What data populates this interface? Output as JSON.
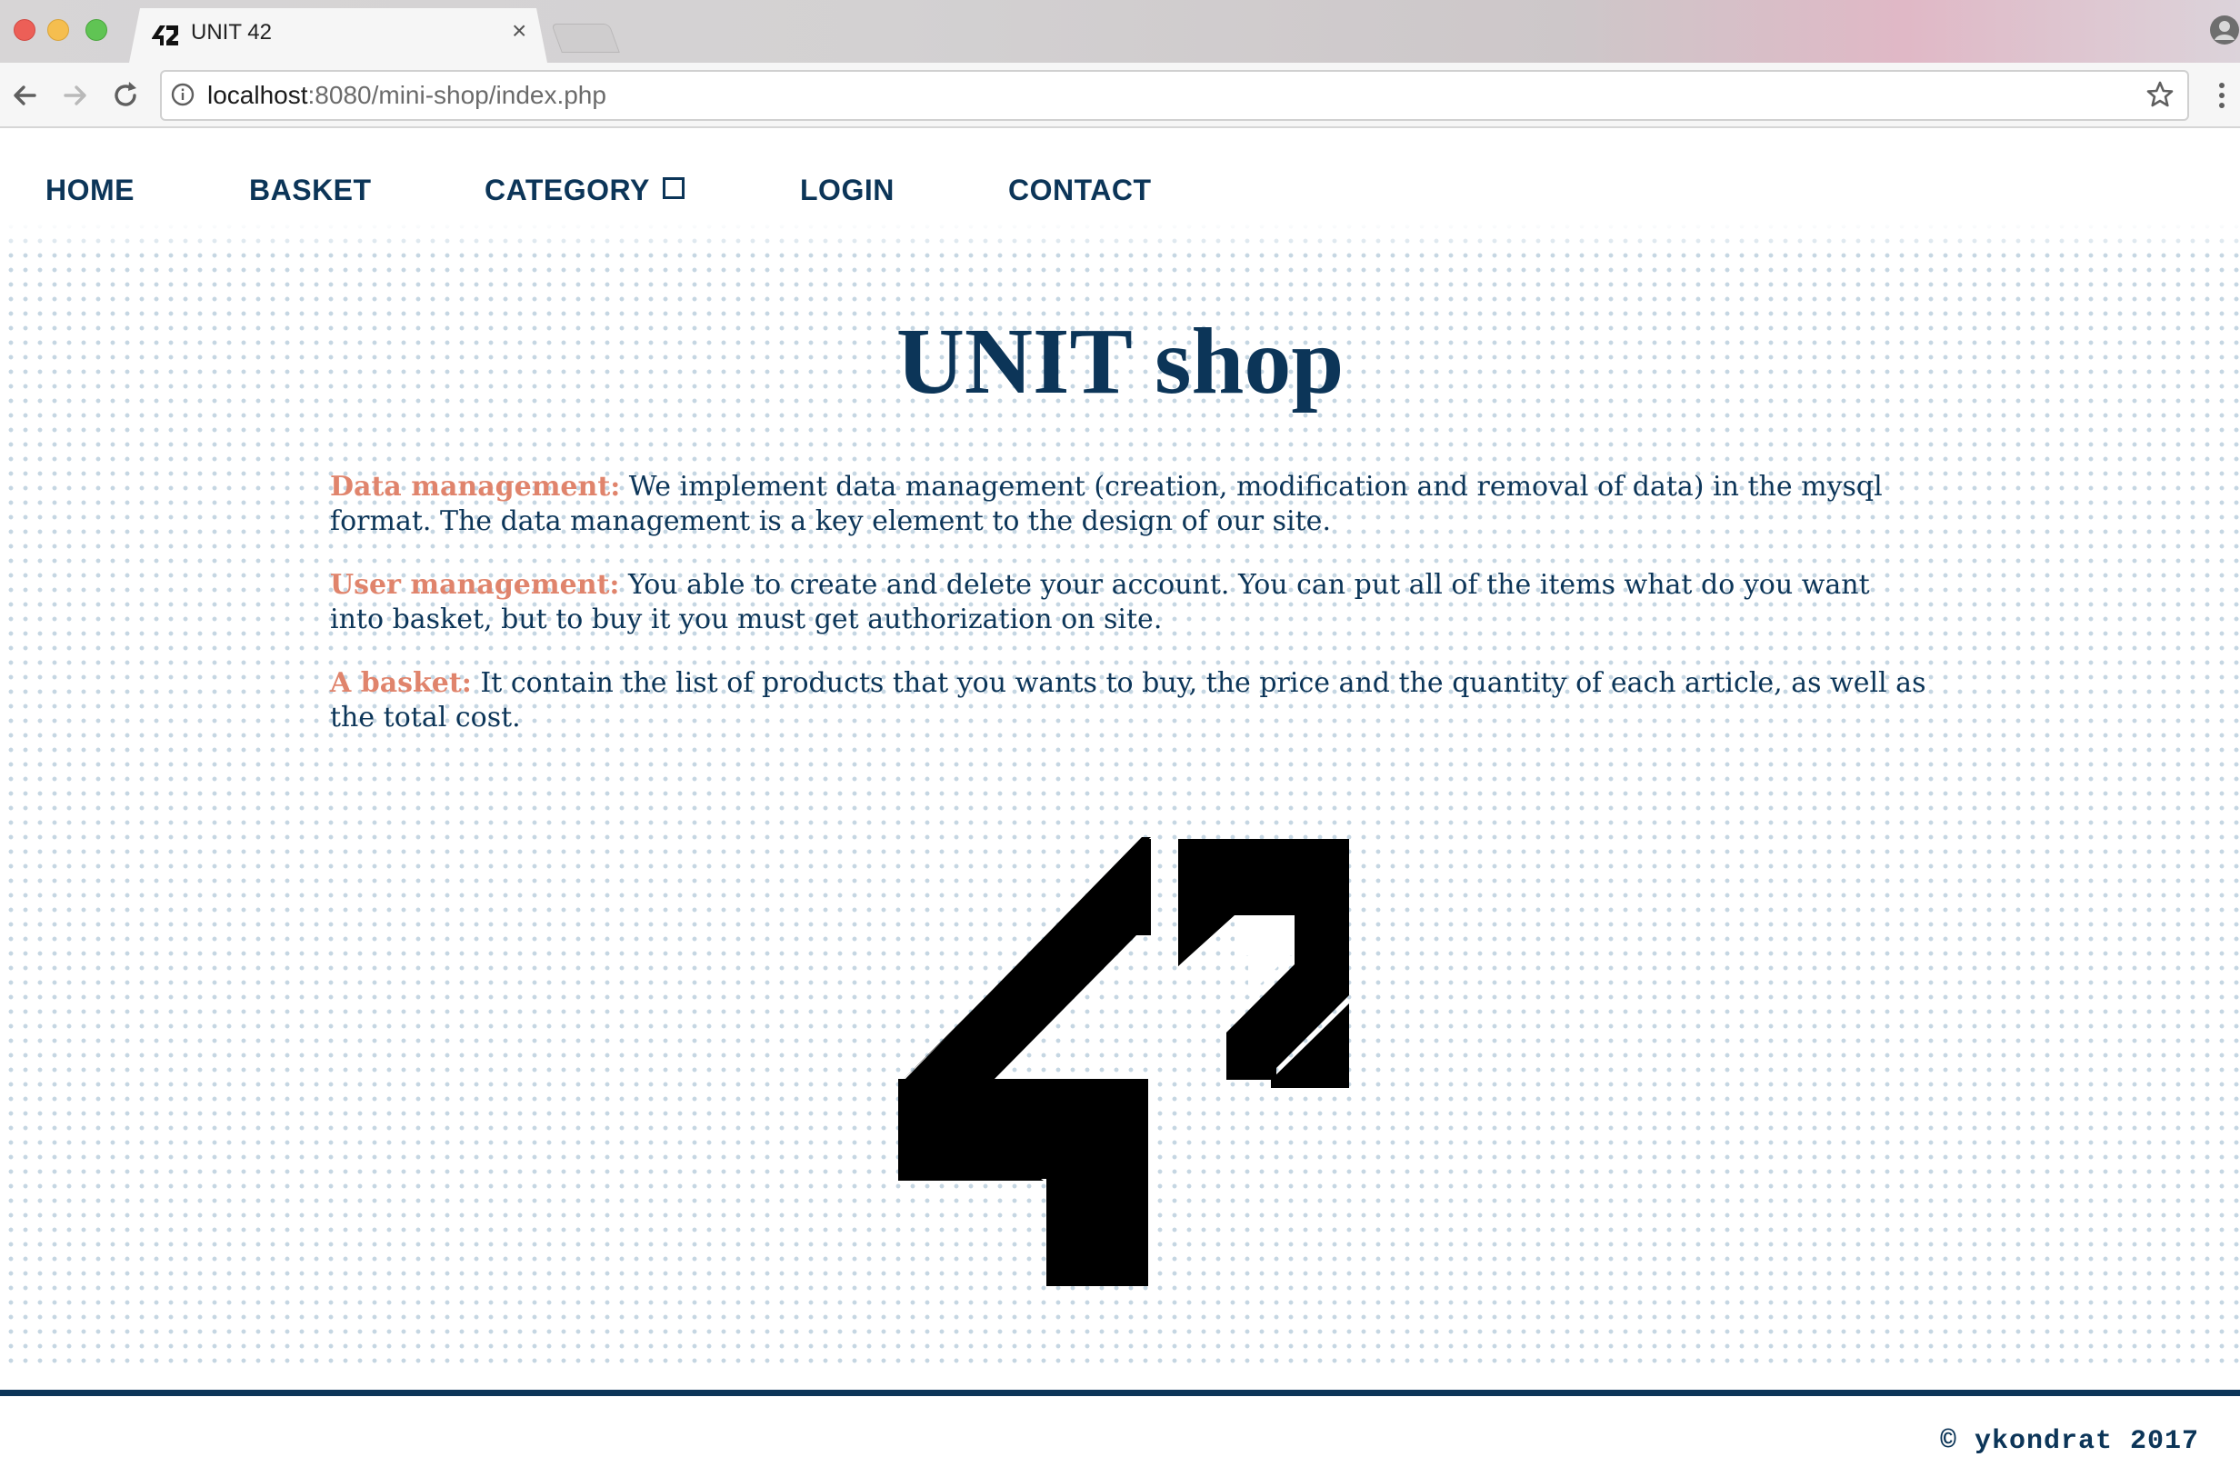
{
  "browser": {
    "tab_title": "UNIT 42",
    "tab_close": "×",
    "url_host": "localhost",
    "url_rest": ":8080/mini-shop/index.php"
  },
  "nav": {
    "items": [
      {
        "label": "HOME"
      },
      {
        "label": "BASKET"
      },
      {
        "label": "CATEGORY"
      },
      {
        "label": "LOGIN"
      },
      {
        "label": "CONTACT"
      }
    ]
  },
  "main": {
    "title": "UNIT shop",
    "sections": [
      {
        "label": "Data management:",
        "text": " We implement data management (creation, modification and removal of data) in the mysql format. The data management is a key element to the design of our site."
      },
      {
        "label": "User management:",
        "text": " You able to create and delete your account. You can put all of the items what do you want into basket, but to buy it you must get authorization on site."
      },
      {
        "label": "A basket:",
        "text": " It contain the list of products that you wants to buy, the price and the quantity of each article, as well as the total cost."
      }
    ],
    "logo_text": "42"
  },
  "footer": {
    "copyright": "© ykondrat 2017"
  },
  "colors": {
    "primary": "#0c3558",
    "accent": "#e0846c",
    "dots": "#c5d6e2"
  }
}
